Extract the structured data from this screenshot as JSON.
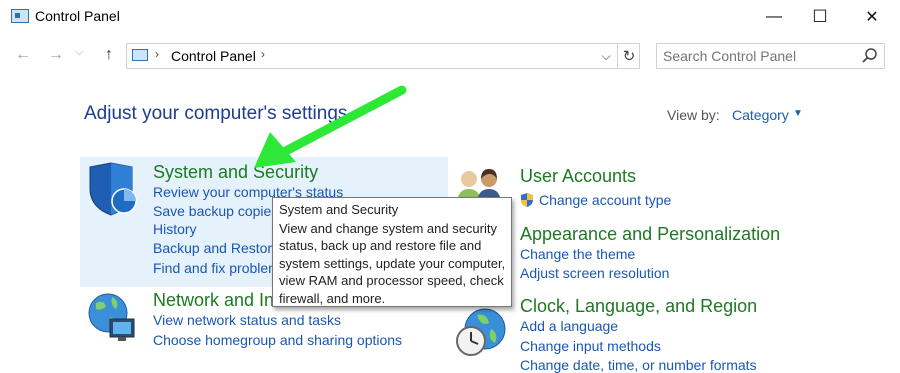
{
  "window": {
    "title": "Control Panel",
    "minimize_symbol": "—",
    "maximize_symbol": "☐",
    "close_symbol": "✕"
  },
  "nav": {
    "back_symbol": "←",
    "forward_symbol": "→",
    "up_symbol": "↑",
    "address_separator": "›",
    "breadcrumb": "Control Panel",
    "dropdown_symbol": "⌵",
    "refresh_symbol": "↻"
  },
  "search": {
    "placeholder": "Search Control Panel"
  },
  "main": {
    "heading": "Adjust your computer's settings",
    "view_by_label": "View by:",
    "view_by_value": "Category",
    "view_by_caret": "▼"
  },
  "categories": {
    "system_security": {
      "title": "System and Security",
      "links": [
        "Review your computer's status",
        "Save backup copies",
        "History",
        "Backup and Restore",
        "Find and fix problem"
      ]
    },
    "network": {
      "title": "Network and In",
      "links": [
        "View network status and tasks",
        "Choose homegroup and sharing options"
      ]
    },
    "user_accounts": {
      "title": "User Accounts",
      "links": [
        "Change account type"
      ]
    },
    "appearance": {
      "title": "Appearance and Personalization",
      "links": [
        "Change the theme",
        "Adjust screen resolution"
      ]
    },
    "clock": {
      "title": "Clock, Language, and Region",
      "links": [
        "Add a language",
        "Change input methods",
        "Change date, time, or number formats"
      ]
    }
  },
  "tooltip": {
    "title": "System and Security",
    "body": "View and change system and security status, back up and restore file and system settings, update your computer, view RAM and processor speed, check firewall, and more."
  },
  "colors": {
    "accent_blue": "#1a57b3",
    "category_green": "#1d7a22",
    "highlight": "#e5f1fb",
    "arrow_green": "#2ee838"
  }
}
